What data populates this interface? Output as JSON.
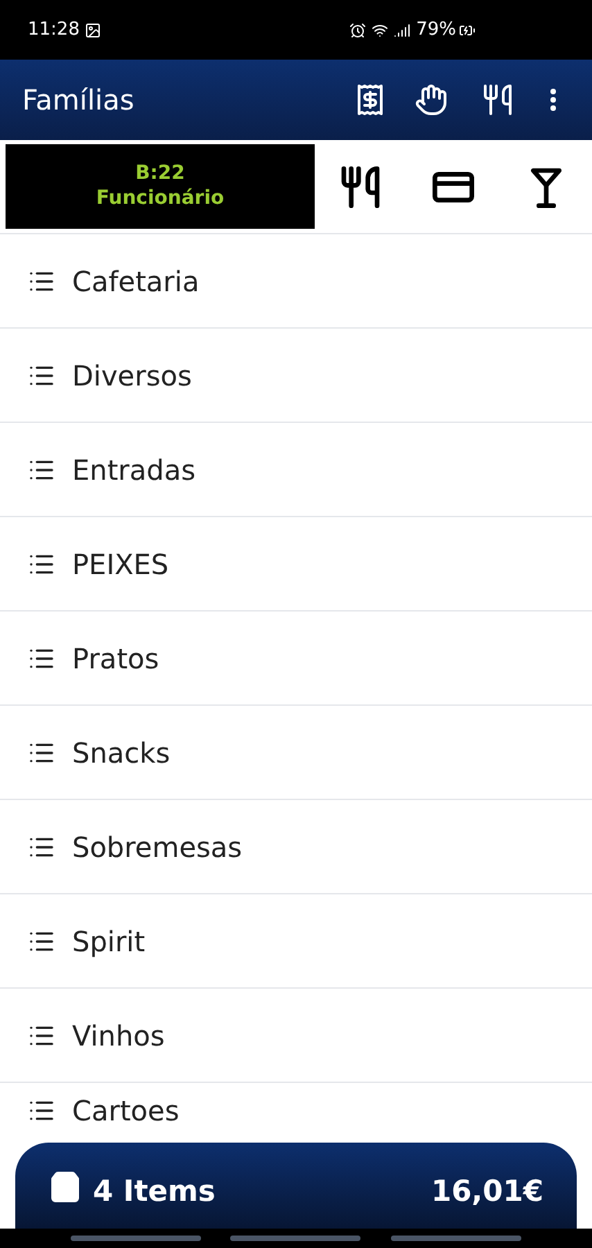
{
  "status_bar": {
    "time": "11:28",
    "battery": "79%"
  },
  "app_bar": {
    "title": "Famílias"
  },
  "table_badge": {
    "table": "B:22",
    "user": "Funcionário"
  },
  "families": [
    {
      "label": "Cafetaria"
    },
    {
      "label": "Diversos"
    },
    {
      "label": "Entradas"
    },
    {
      "label": "PEIXES"
    },
    {
      "label": "Pratos"
    },
    {
      "label": "Snacks"
    },
    {
      "label": "Sobremesas"
    },
    {
      "label": "Spirit"
    },
    {
      "label": "Vinhos"
    },
    {
      "label": "Cartoes"
    }
  ],
  "cart": {
    "items": "4 Items",
    "total": "16,01€"
  }
}
